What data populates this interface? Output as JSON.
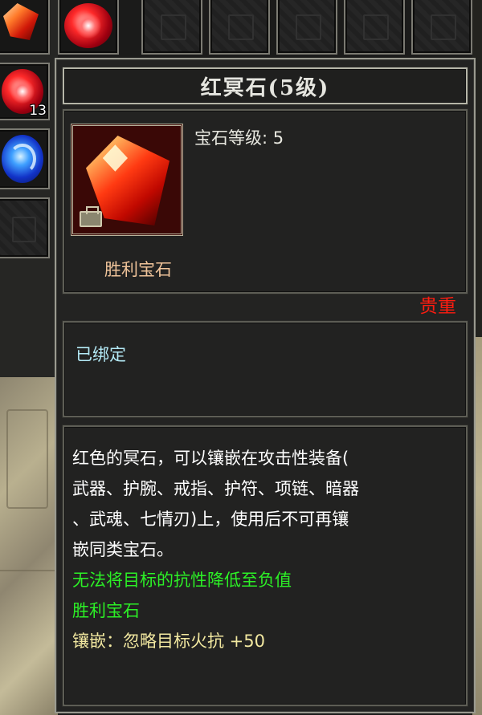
{
  "inventory": {
    "slot_count_label": "13"
  },
  "tooltip": {
    "title": "红冥石(5级)",
    "gem_level": "宝石等级: 5",
    "gem_type": "胜利宝石",
    "rarity": "贵重",
    "bind_status": "已绑定",
    "description_lines": [
      "红色的冥石，可以镶嵌在攻击性装备(",
      "武器、护腕、戒指、护符、项链、暗器",
      "、武魂、七情刃)上，使用后不可再镶",
      "嵌同类宝石。"
    ],
    "restriction": "无法将目标的抗性降低至负值",
    "gem_type_repeat": "胜利宝石",
    "socket_effect": "镶嵌：忽略目标火抗 +50"
  },
  "colors": {
    "title": "#e6e6e0",
    "gem_type": "#f0c49a",
    "rarity": "#ff1c10",
    "bound": "#b4eaf6",
    "effect_green": "#2cf026",
    "effect_yellow": "#f2e8a0"
  }
}
